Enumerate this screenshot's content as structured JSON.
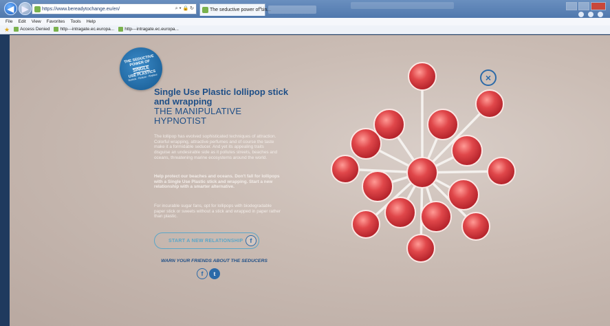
{
  "browser": {
    "address_url": "https://www.bereadytochange.eu/en/",
    "address_tools": "⌕ ▾ 🔒 ↻",
    "tab_title": "The seductive power of sin...",
    "tab_close": "×",
    "back_icon": "arrow-left-icon",
    "forward_icon": "arrow-right-icon",
    "menu": [
      "File",
      "Edit",
      "View",
      "Favorites",
      "Tools",
      "Help"
    ],
    "favorites": [
      "Access Denied",
      "http---intragate.ec.europa...",
      "http---intragate.ec.europa..."
    ]
  },
  "page": {
    "badge": {
      "line1": "THE SEDUCTIVE",
      "line2": "POWER OF",
      "line3": "SINGLE",
      "line4": "USE PLASTICS",
      "line5": "Rethink · Reduce · Replace"
    },
    "title_bold": "Single Use Plastic lollipop stick and wrapping",
    "title_sub": "THE MANIPULATIVE HYPNOTIST",
    "paragraph1": "The lollipop has evolved sophisticated techniques of attraction. Colorful wrapping, attractive perfumes and of course the taste make it a formidable seducer. And yet its appealing traits disguise an undesirable side as it pollutes streets, beaches and oceans, threatening marine ecosystems around the world.",
    "paragraph2": "Help protect our beaches and oceans. Don't fall for lollipops with a Single Use Plastic stick and wrapping. Start a new relationship with a smarter alternative.",
    "paragraph3": "For incurable sugar fans, opt for lollipops with biodegradable paper stick or sweets without a stick and wrapped in paper rather than plastic.",
    "cta_label": "START A NEW RELATIONSHIP",
    "cta_fb": "f",
    "warn_text": "WARN YOUR FRIENDS ABOUT THE SEDUCERS",
    "social_fb": "f",
    "social_tw": "t",
    "close_symbol": "×"
  },
  "colors": {
    "accent_blue": "#1f4f87",
    "cta_blue": "#5aa6c8",
    "lollipop_red": "#e0474a"
  }
}
